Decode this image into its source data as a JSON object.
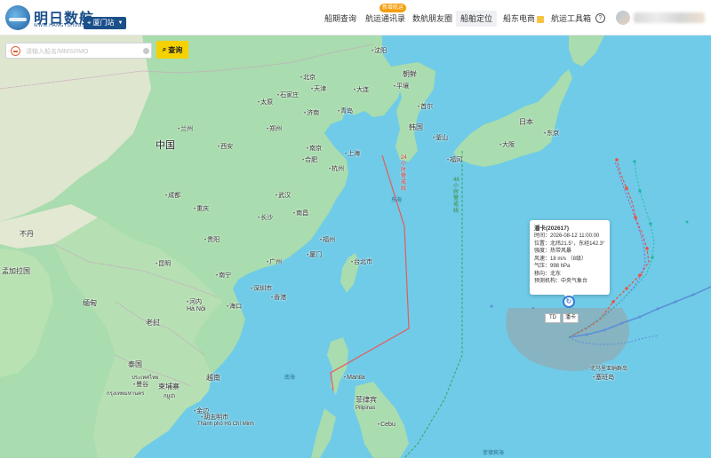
{
  "header": {
    "brand": "明日数航",
    "brand_sub": "WWW.HANGYSHUGS.COM",
    "port": "厦门站",
    "nav": {
      "ship_query": "船期查询",
      "shipping_news": "航运通讯录",
      "news_badge": "新增航运",
      "shipping_circle": "数航朋友圈",
      "ship_position": "船舶定位",
      "ecommerce": "船东电商",
      "tools": "航运工具箱"
    }
  },
  "search": {
    "placeholder": "请输入船名/MMSI/IMO",
    "button": "查询"
  },
  "map": {
    "countries": {
      "china": "中国",
      "korea_north": "朝鲜",
      "korea_south": "韩国",
      "japan": "日本",
      "laos": "老挝",
      "thailand": "泰国",
      "cambodia": "柬埔寨",
      "cambodia_local": "កម្ពុជា",
      "thailand_local": "ประเทศไทย",
      "vietnam": "越南",
      "myanmar": "缅甸",
      "bangladesh": "孟加拉国",
      "bhutan": "不丹",
      "philippines": "菲律宾",
      "philippines_en": "Pilipinas",
      "northern_marianas": "北马里亚纳群岛"
    },
    "cities": {
      "shenyang": "沈阳",
      "beijing": "北京",
      "tianjin": "天津",
      "dalian": "大连",
      "qingdao": "青岛",
      "jinan": "济南",
      "taiyuan": "太原",
      "shijiazhuang": "石家庄",
      "zhengzhou": "郑州",
      "xian": "西安",
      "lanzhou": "兰州",
      "nanjing": "南京",
      "shanghai": "上海",
      "hangzhou": "杭州",
      "hefei": "合肥",
      "wuhan": "武汉",
      "changsha": "长沙",
      "nanchang": "南昌",
      "fuzhou": "福州",
      "xiamen": "厦门",
      "taipei": "台北市",
      "guangzhou": "广州",
      "shenzhen": "深圳市",
      "hongkong": "香港",
      "chongqing": "重庆",
      "chengdu": "成都",
      "guiyang": "贵阳",
      "kunming": "昆明",
      "nanning": "南宁",
      "haikou": "海口",
      "hanoi": "河内",
      "hanoi_local": "Hà Nội",
      "bangkok": "曼谷",
      "bangkok_local": "กรุงเทพมหานคร",
      "phnompenh": "金边",
      "hcmc": "胡志明市",
      "hcmc_local": "Thành phố Hồ Chí Minh",
      "manila": "Manila",
      "cebu": "Cebu",
      "pyongyang": "平壤",
      "seoul": "首尔",
      "busan": "釜山",
      "fukuoka": "福冈",
      "osaka": "大阪",
      "tokyo": "东京",
      "saipan": "塞班岛"
    },
    "seas": {
      "east_china_sea": "东海",
      "south_china_sea": "南海",
      "philippine_sea": "菲律宾海"
    },
    "lines": {
      "warning_24": "24小时警戒线",
      "warning_48": "48小时警戒线"
    }
  },
  "typhoon": {
    "title": "潘卡(202617)",
    "time": "时间：2026-08-12 11:00:00",
    "position": "位置：北纬21.5°，东经142.3°",
    "intensity": "强度：热带风暴",
    "wind": "风速：18 m/s （8级）",
    "pressure": "气压：998 hPa",
    "direction": "移向：北东",
    "agency": "预测机构：中央气象台",
    "td": "TD",
    "name": "潘卡",
    "colors": {
      "track": "#5b8fd8",
      "forecast_red": "#e8543a",
      "forecast_green": "#2bb5a7",
      "forecast_purple": "#a55ac8",
      "wind_circle": "#9aa4a6"
    }
  }
}
